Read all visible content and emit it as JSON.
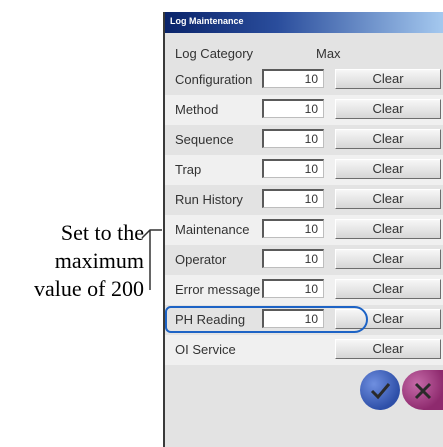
{
  "annotation": {
    "lines": [
      "Set to the",
      "maximum",
      "value of 200"
    ]
  },
  "window": {
    "title": "Log Maintenance"
  },
  "header": {
    "category_label": "Log Category",
    "max_label": "Max"
  },
  "rows": [
    {
      "category": "Configuration",
      "max": "10",
      "clear": "Clear"
    },
    {
      "category": "Method",
      "max": "10",
      "clear": "Clear"
    },
    {
      "category": "Sequence",
      "max": "10",
      "clear": "Clear"
    },
    {
      "category": "Trap",
      "max": "10",
      "clear": "Clear"
    },
    {
      "category": "Run History",
      "max": "10",
      "clear": "Clear"
    },
    {
      "category": "Maintenance",
      "max": "10",
      "clear": "Clear"
    },
    {
      "category": "Operator",
      "max": "10",
      "clear": "Clear"
    },
    {
      "category": "Error message",
      "max": "10",
      "clear": "Clear"
    },
    {
      "category": "PH Reading",
      "max": "10",
      "clear": "Clear"
    },
    {
      "category": "OI Service",
      "max": "",
      "clear": "Clear"
    }
  ],
  "colors": {
    "highlight": "#1d63c5",
    "ok_button": "#2e4fa8",
    "cancel_button": "#8e2a6e"
  },
  "icons": {
    "ok": "check-icon",
    "cancel": "close-icon"
  }
}
